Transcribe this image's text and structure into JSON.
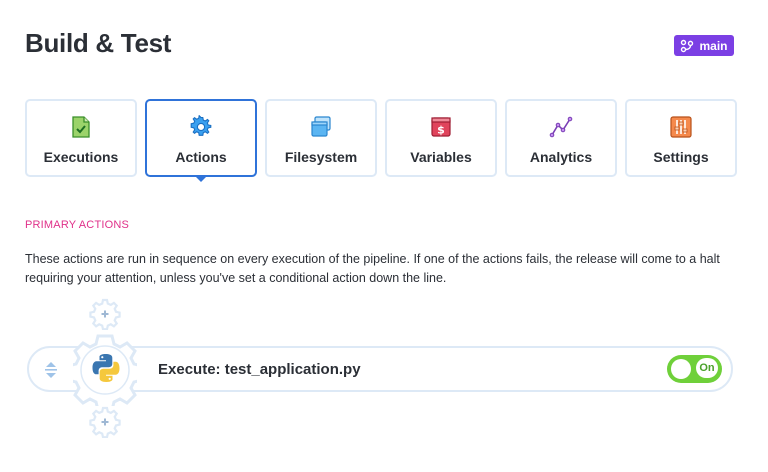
{
  "header": {
    "title": "Build & Test",
    "branch_badge": "main"
  },
  "tabs": [
    {
      "label": "Executions",
      "icon": "file-check-icon",
      "active": false
    },
    {
      "label": "Actions",
      "icon": "gear-icon",
      "active": true
    },
    {
      "label": "Filesystem",
      "icon": "folder-window-icon",
      "active": false
    },
    {
      "label": "Variables",
      "icon": "dollar-box-icon",
      "active": false
    },
    {
      "label": "Analytics",
      "icon": "line-chart-icon",
      "active": false
    },
    {
      "label": "Settings",
      "icon": "sliders-icon",
      "active": false
    }
  ],
  "section": {
    "heading": "PRIMARY ACTIONS",
    "description": "These actions are run in sequence on every execution of the pipeline. If one of the actions fails, the release will come to a halt requiring your attention, unless you've set a conditional action down the line."
  },
  "actions": [
    {
      "title": "Execute: test_application.py",
      "icon": "python-icon",
      "toggle_label": "On",
      "enabled": true
    }
  ],
  "colors": {
    "accent_blue": "#2f73d9",
    "badge_purple": "#7b3fe4",
    "section_pink": "#e0318a",
    "toggle_green": "#6fd03a",
    "border_light": "#dde9f6"
  }
}
